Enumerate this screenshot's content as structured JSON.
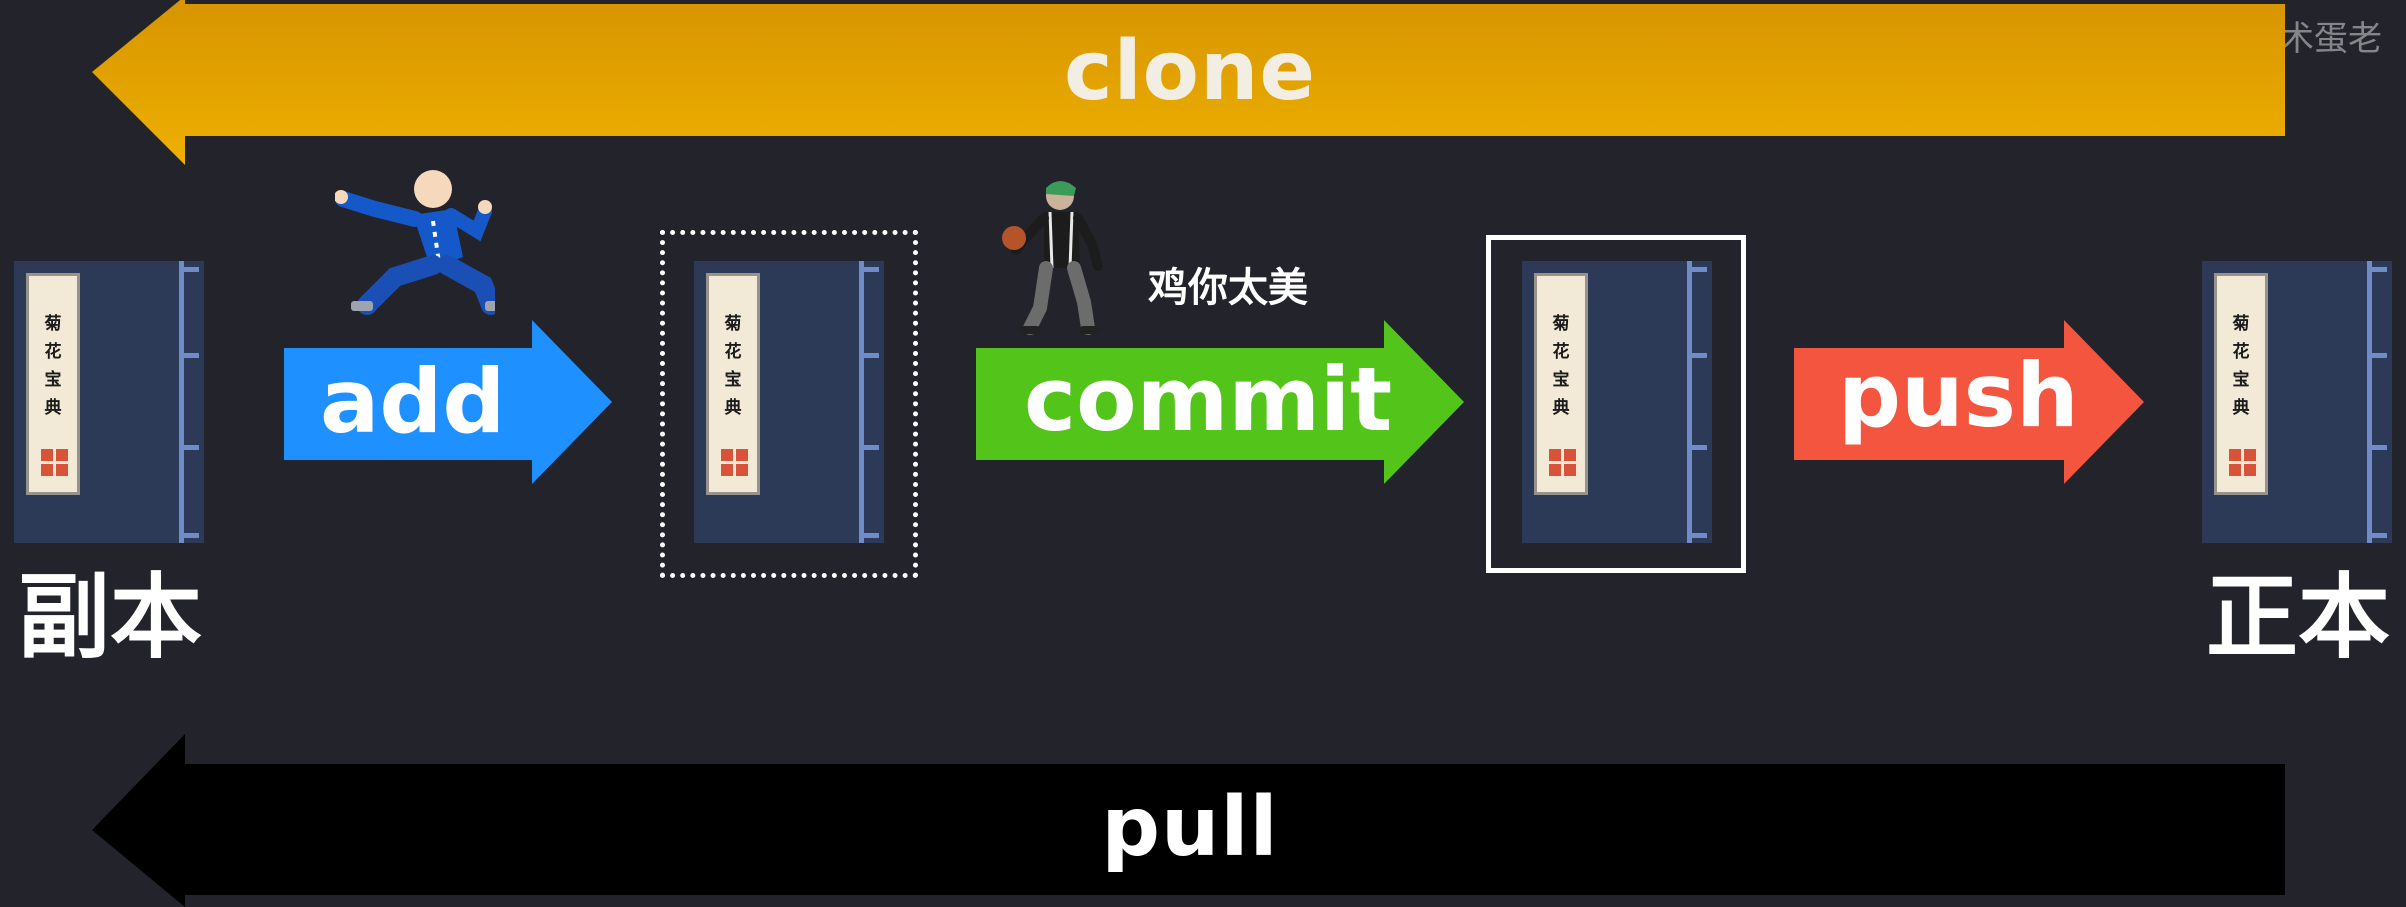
{
  "watermark": "@技术蛋老",
  "arrows": {
    "clone": {
      "label": "clone",
      "color": "#e7a700"
    },
    "pull": {
      "label": "pull",
      "color": "#000000"
    },
    "add": {
      "label": "add",
      "color": "#1e90ff"
    },
    "commit": {
      "label": "commit",
      "color": "#52c41a"
    },
    "push": {
      "label": "push",
      "color": "#f4553f"
    }
  },
  "books": [
    {
      "title_chars": [
        "菊",
        "花",
        "宝",
        "典"
      ]
    },
    {
      "title_chars": [
        "菊",
        "花",
        "宝",
        "典"
      ]
    },
    {
      "title_chars": [
        "菊",
        "花",
        "宝",
        "典"
      ]
    },
    {
      "title_chars": [
        "菊",
        "花",
        "宝",
        "典"
      ]
    }
  ],
  "labels": {
    "copy": "副本",
    "original": "正本"
  },
  "commit_caption": "鸡你太美",
  "figures": {
    "add_figure": "kungfu-person-icon",
    "commit_figure": "basketball-player-icon"
  }
}
